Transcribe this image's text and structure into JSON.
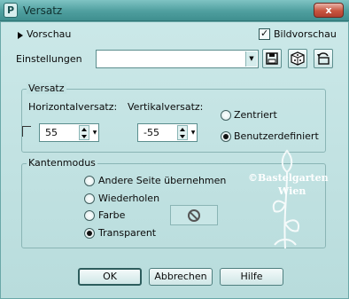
{
  "window": {
    "title": "Versatz",
    "app_icon_glyph": "P",
    "close_glyph": "x"
  },
  "preview": {
    "toggle_label": "Vorschau",
    "image_preview_label": "Bildvorschau",
    "image_preview_checked": true
  },
  "settings": {
    "label": "Einstellungen",
    "combo_value": ""
  },
  "offset": {
    "group_label": "Versatz",
    "horizontal_label": "Horizontalversatz:",
    "horizontal_value": "55",
    "vertical_label": "Vertikalversatz:",
    "vertical_value": "-55",
    "options": [
      {
        "label": "Zentriert",
        "selected": false
      },
      {
        "label": "Benutzerdefiniert",
        "selected": true
      }
    ]
  },
  "edge_mode": {
    "group_label": "Kantenmodus",
    "options": [
      {
        "label": "Andere Seite übernehmen",
        "selected": false
      },
      {
        "label": "Wiederholen",
        "selected": false
      },
      {
        "label": "Farbe",
        "selected": false
      },
      {
        "label": "Transparent",
        "selected": true
      }
    ]
  },
  "watermark": {
    "line1": "©Bastelgarten",
    "line2": "Wien"
  },
  "buttons": {
    "ok": "OK",
    "cancel": "Abbrechen",
    "help": "Hilfe"
  },
  "colors": {
    "background": "#c4e4e4",
    "titlebar": "#4f9f9f",
    "close": "#c8553f"
  }
}
